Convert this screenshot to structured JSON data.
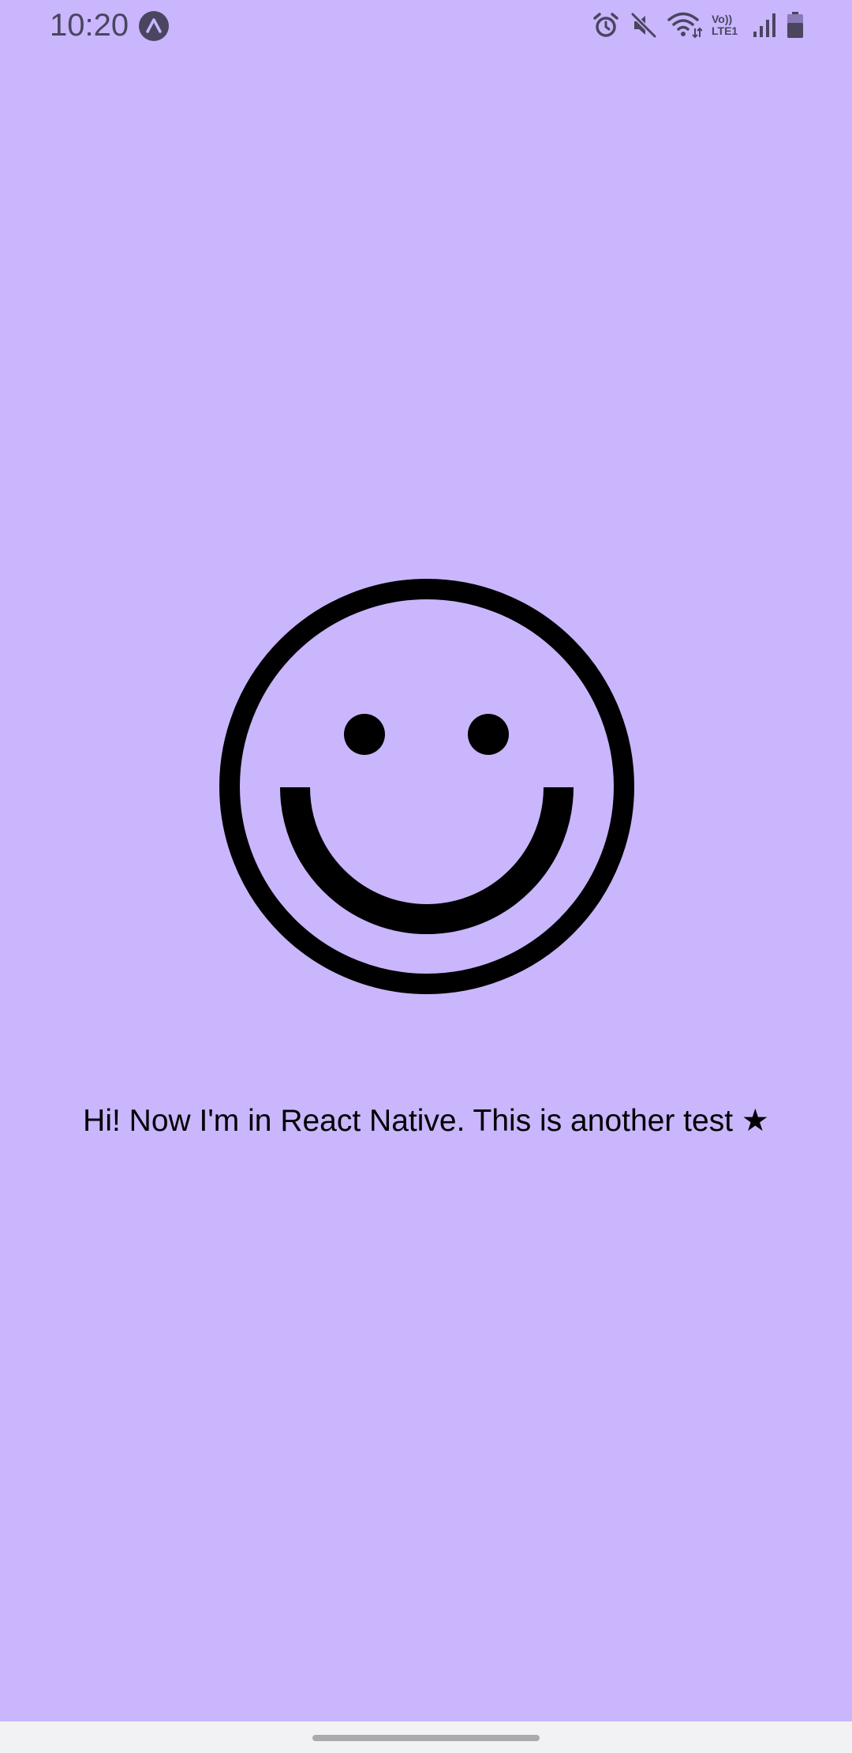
{
  "status_bar": {
    "time": "10:20",
    "network_label_top": "Vo))",
    "network_label_bottom": "LTE1",
    "icons": [
      "expo-icon",
      "alarm-icon",
      "mute-icon",
      "wifi-icon",
      "volte-lte-indicator",
      "signal-icon",
      "battery-icon"
    ]
  },
  "content": {
    "illustration": "smiley-face-icon",
    "message": "Hi! Now I'm in React Native. This is another test ★"
  },
  "colors": {
    "background": "#c9b6fc",
    "status_icons": "#4a4560",
    "foreground": "#000000",
    "nav_bar": "#f2f1f3"
  }
}
